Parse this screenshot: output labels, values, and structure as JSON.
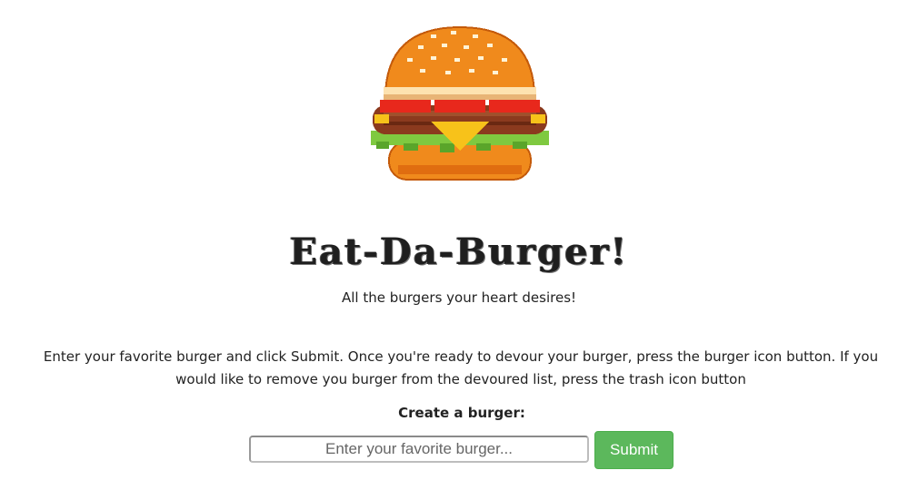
{
  "header": {
    "logo_icon": "pixel-burger-icon",
    "title": "Eat-Da-Burger!",
    "tagline": "All the burgers your heart desires!"
  },
  "instructions": {
    "text": "Enter your favorite burger and click Submit. Once you're ready to devour your burger, press the burger icon button. If you would like to remove you burger from the devoured list, press the trash icon button"
  },
  "form": {
    "label": "Create a burger:",
    "input_value": "",
    "input_placeholder": "Enter your favorite burger...",
    "submit_label": "Submit"
  },
  "colors": {
    "submit_bg": "#5cb85c",
    "bun": "#f08a1c",
    "patty": "#8b3a1e",
    "lettuce": "#7fc940",
    "tomato": "#e8281c",
    "cheese": "#f7c21a"
  }
}
